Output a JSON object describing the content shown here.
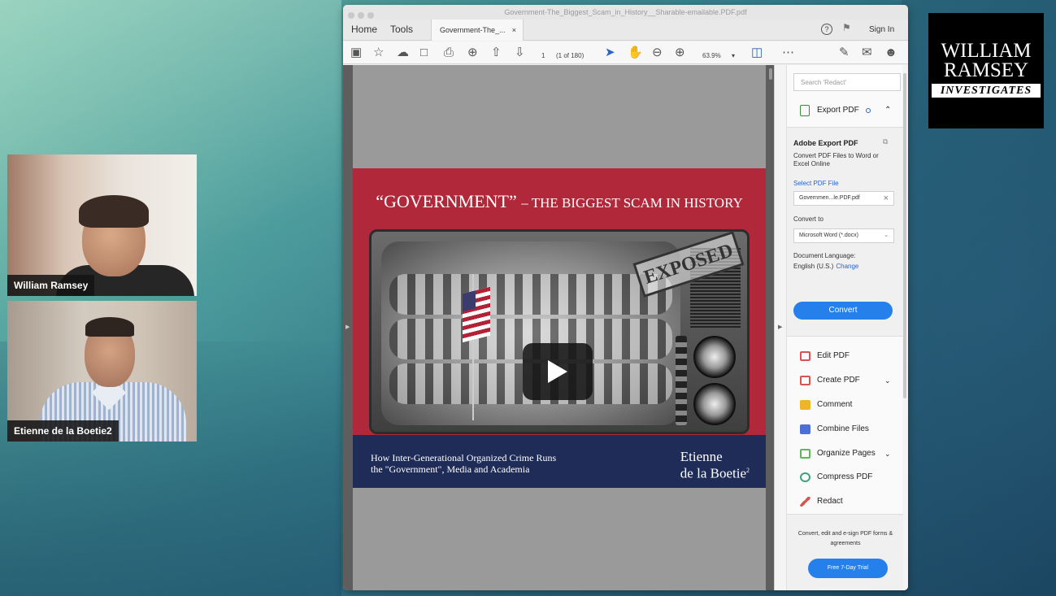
{
  "participants": [
    {
      "name": "William Ramsey"
    },
    {
      "name": "Etienne de la Boetie2"
    }
  ],
  "logo": {
    "line1": "WILLIAM",
    "line2": "RAMSEY",
    "line3": "INVESTIGATES"
  },
  "acrobat": {
    "window_title": "Government-The_Biggest_Scam_in_History__Sharable-emailable.PDF.pdf",
    "menu": {
      "home": "Home",
      "tools": "Tools"
    },
    "doc_tab": {
      "label": "Government-The_...",
      "close": "×"
    },
    "help_label": "?",
    "sign_in": "Sign In",
    "toolbar": {
      "page_number": "1",
      "page_count": "(1 of 180)",
      "zoom": "63.9%"
    }
  },
  "cover": {
    "title_main": "“GOVERNMENT”",
    "title_rest": "– THE BIGGEST SCAM IN HISTORY",
    "stamp": "EXPOSED",
    "subtitle_line1": "How Inter-Generational Organized Crime Runs",
    "subtitle_line2": "the \"Government\", Media and Academia",
    "author_line1": "Etienne",
    "author_line2": "de la Boetie",
    "author_sup": "2"
  },
  "tools_pane": {
    "search_placeholder": "Search 'Redact'",
    "export_pdf": "Export PDF",
    "export_box": {
      "title": "Adobe Export PDF",
      "description": "Convert PDF Files to Word or Excel Online",
      "select_file": "Select PDF File",
      "file_name": "Governmen...le.PDF.pdf",
      "convert_to_label": "Convert to",
      "convert_to_value": "Microsoft Word (*.docx)",
      "document_language_label": "Document Language:",
      "document_language_value": "English (U.S.)",
      "change": "Change",
      "convert_button": "Convert"
    },
    "tools": [
      {
        "label": "Edit PDF"
      },
      {
        "label": "Create PDF"
      },
      {
        "label": "Comment"
      },
      {
        "label": "Combine Files"
      },
      {
        "label": "Organize Pages"
      },
      {
        "label": "Compress PDF"
      },
      {
        "label": "Redact"
      }
    ],
    "footer_text": "Convert, edit and e-sign PDF forms & agreements",
    "trial_button": "Free 7-Day Trial"
  },
  "colors": {
    "cover_red": "#b1283a",
    "cover_navy": "#1e2c57",
    "acrobat_blue": "#2680eb"
  }
}
